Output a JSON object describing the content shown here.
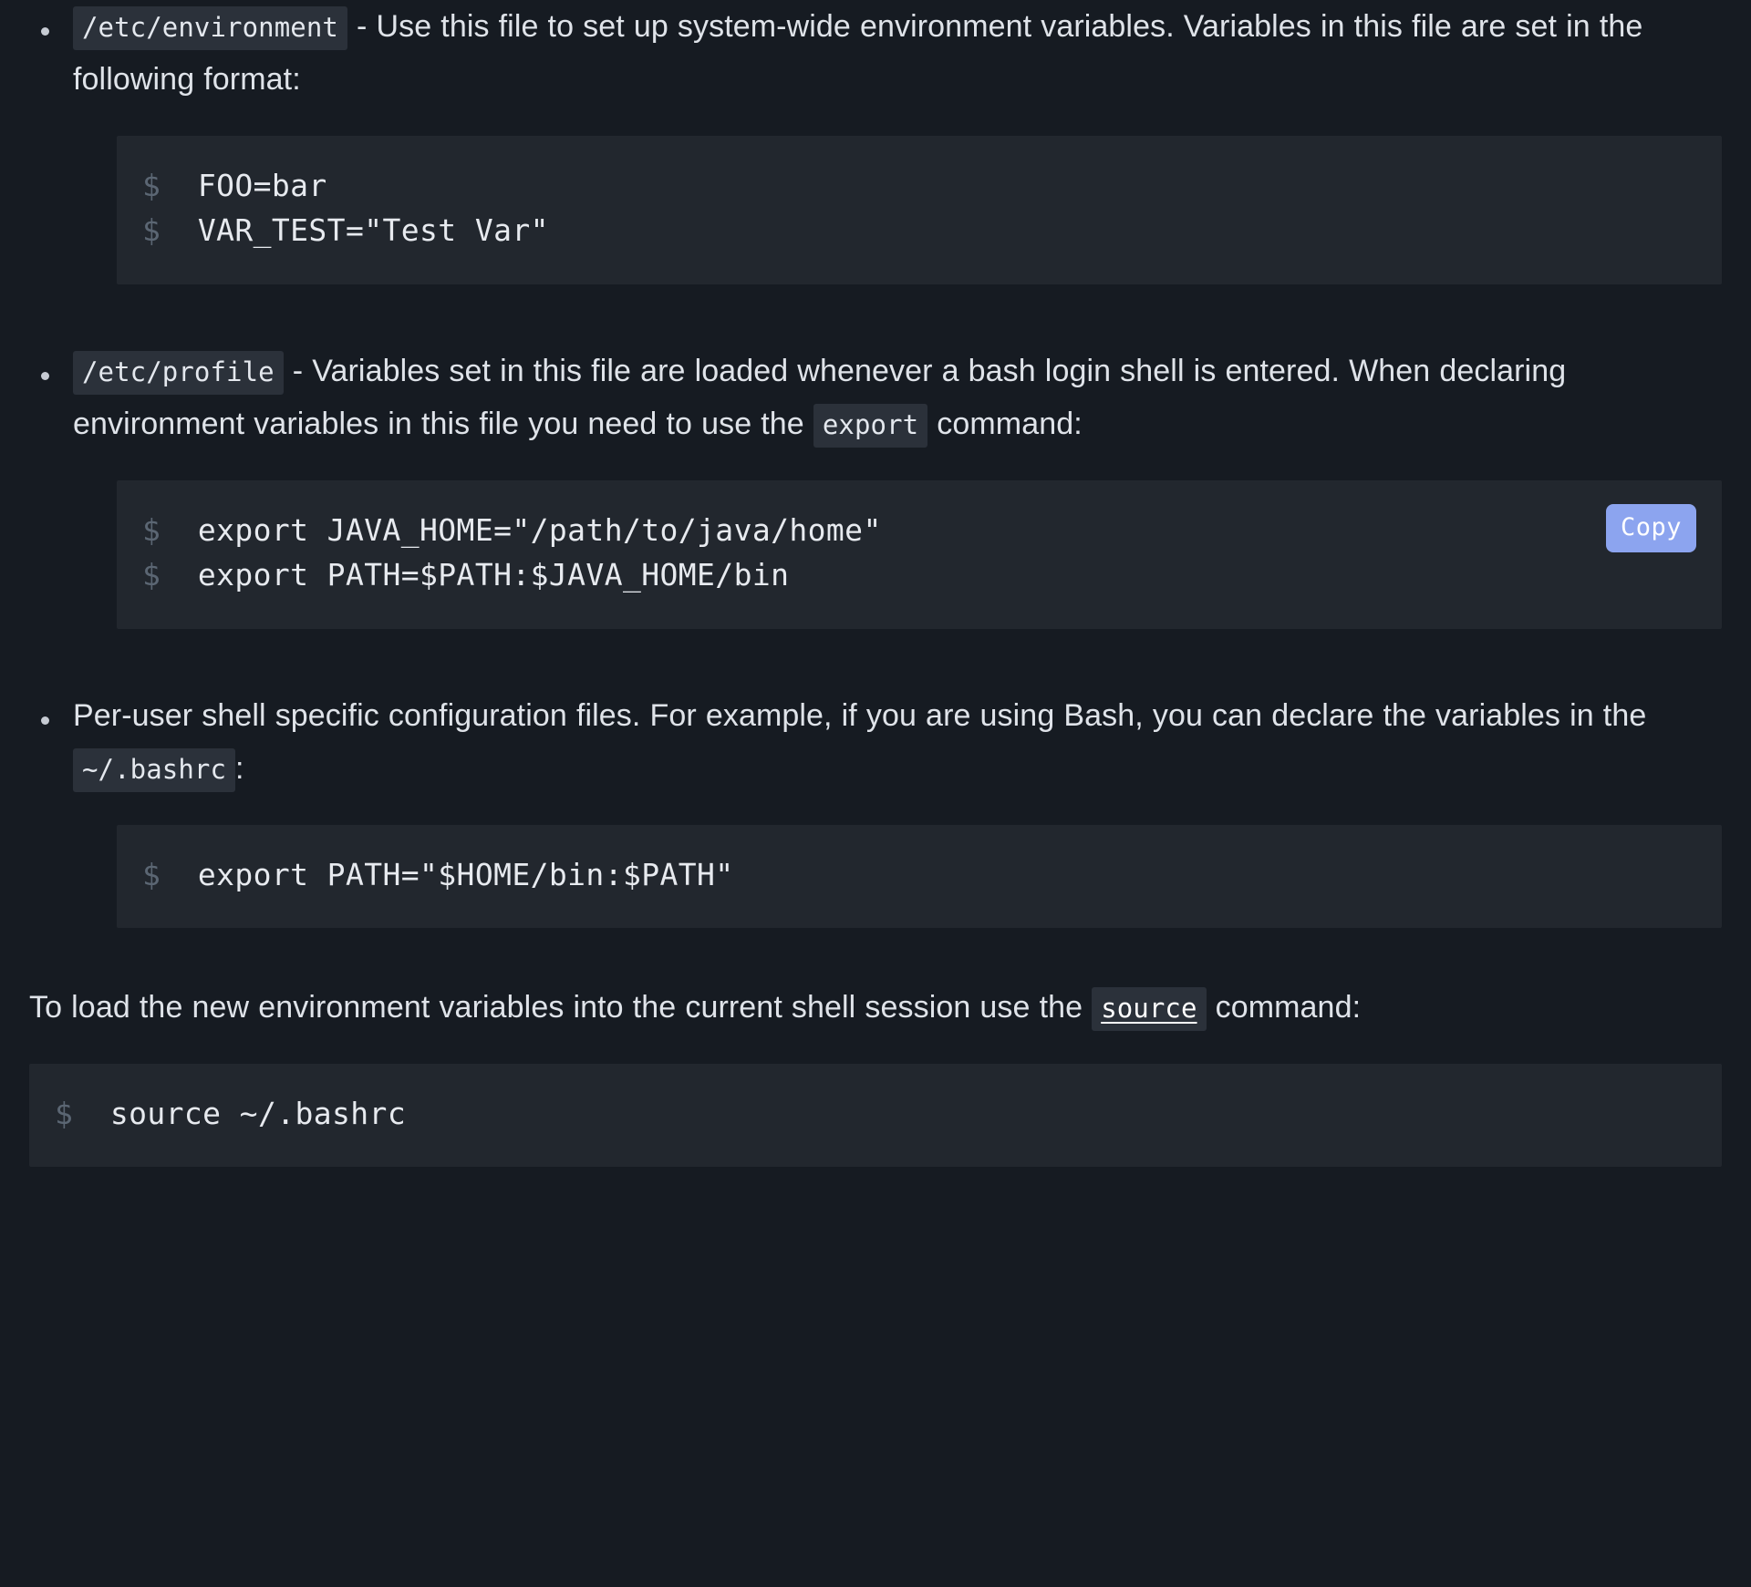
{
  "document": {
    "bullets": [
      {
        "code_label": "/etc/environment",
        "text_after": " - Use this file to set up system-wide environment variables. Variables in this file are set in the following format:",
        "code_block": {
          "prompt": "$",
          "lines": [
            "FOO=bar",
            "VAR_TEST=\"Test Var\""
          ],
          "has_copy_button": false
        }
      },
      {
        "code_label": "/etc/profile",
        "text_after_1": " - Variables set in this file are loaded whenever a bash login shell is entered. When declaring environment variables in this file you need to use the ",
        "inline_code_mid": "export",
        "text_after_2": " command:",
        "code_block": {
          "prompt": "$",
          "lines": [
            "export JAVA_HOME=\"/path/to/java/home\"",
            "export PATH=$PATH:$JAVA_HOME/bin"
          ],
          "has_copy_button": true,
          "copy_label": "Copy"
        }
      },
      {
        "text_before": "Per-user shell specific configuration files. For example, if you are using Bash, you can declare the variables in the ",
        "inline_code": "~/.bashrc",
        "text_after": ":",
        "code_block": {
          "prompt": "$",
          "lines": [
            "export PATH=\"$HOME/bin:$PATH\""
          ],
          "has_copy_button": false
        }
      }
    ],
    "closing_paragraph": {
      "text_before": "To load the new environment variables into the current shell session use the ",
      "inline_code_link": "source",
      "text_after": " command:"
    },
    "final_code_block": {
      "prompt": "$",
      "lines": [
        "source ~/.bashrc"
      ]
    }
  },
  "colors": {
    "page_background": "#161b22",
    "code_block_background": "#22272e",
    "inline_code_background": "#2b313a",
    "text": "#dfe3e9",
    "prompt": "#5b6673",
    "copy_button": "#8ca4ef"
  }
}
